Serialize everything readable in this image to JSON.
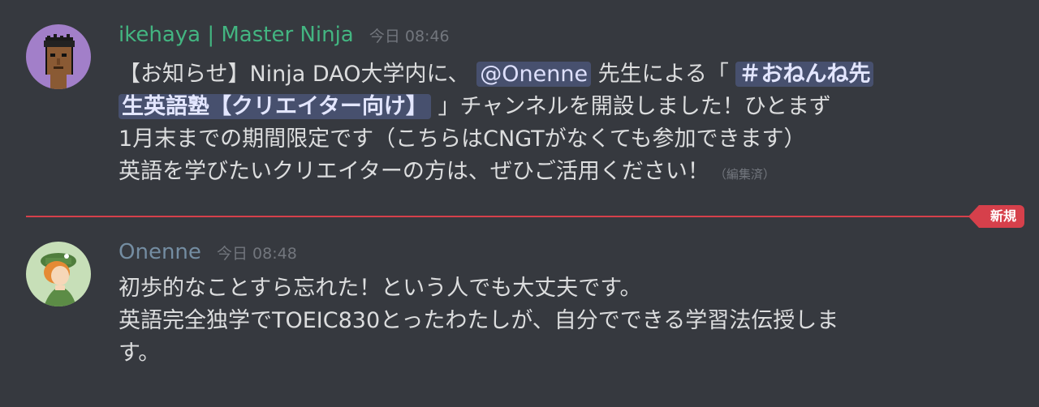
{
  "colors": {
    "background": "#36393f",
    "username_1": "#43b581",
    "username_2": "#748da2",
    "timestamp": "#72767d",
    "new_divider": "#d6404b",
    "mention_bg": "#4b5280"
  },
  "messages": [
    {
      "username": "ikehaya | Master Ninja",
      "timestamp": "今日 08:46",
      "avatar_icon": "pixel-punk-avatar-icon",
      "lines": [
        {
          "a": "【お知らせ】Ninja DAO大学内に、",
          "mention": "@Onenne",
          "b": "先生による「",
          "channel": "＃おねんね先"
        },
        {
          "channel": "生英語塾【クリエイター向け】",
          "b": "」チャンネルを開設しました！ひとまず"
        },
        {
          "a": "1月末までの期間限定です（こちらはCNGTがなくても参加できます）"
        },
        {
          "a": "英語を学びたいクリエイターの方は、ぜひご活用ください！",
          "edited": "（編集済）"
        }
      ]
    },
    {
      "username": "Onenne",
      "timestamp": "今日 08:48",
      "avatar_icon": "illustrated-girl-avatar-icon",
      "lines": [
        {
          "a": "初歩的なことすら忘れた！という人でも大丈夫です。"
        },
        {
          "a": "英語完全独学でTOEIC830とったわたしが、自分でできる学習法伝授しま"
        },
        {
          "a": "す。"
        }
      ]
    }
  ],
  "new_badge": "新規"
}
